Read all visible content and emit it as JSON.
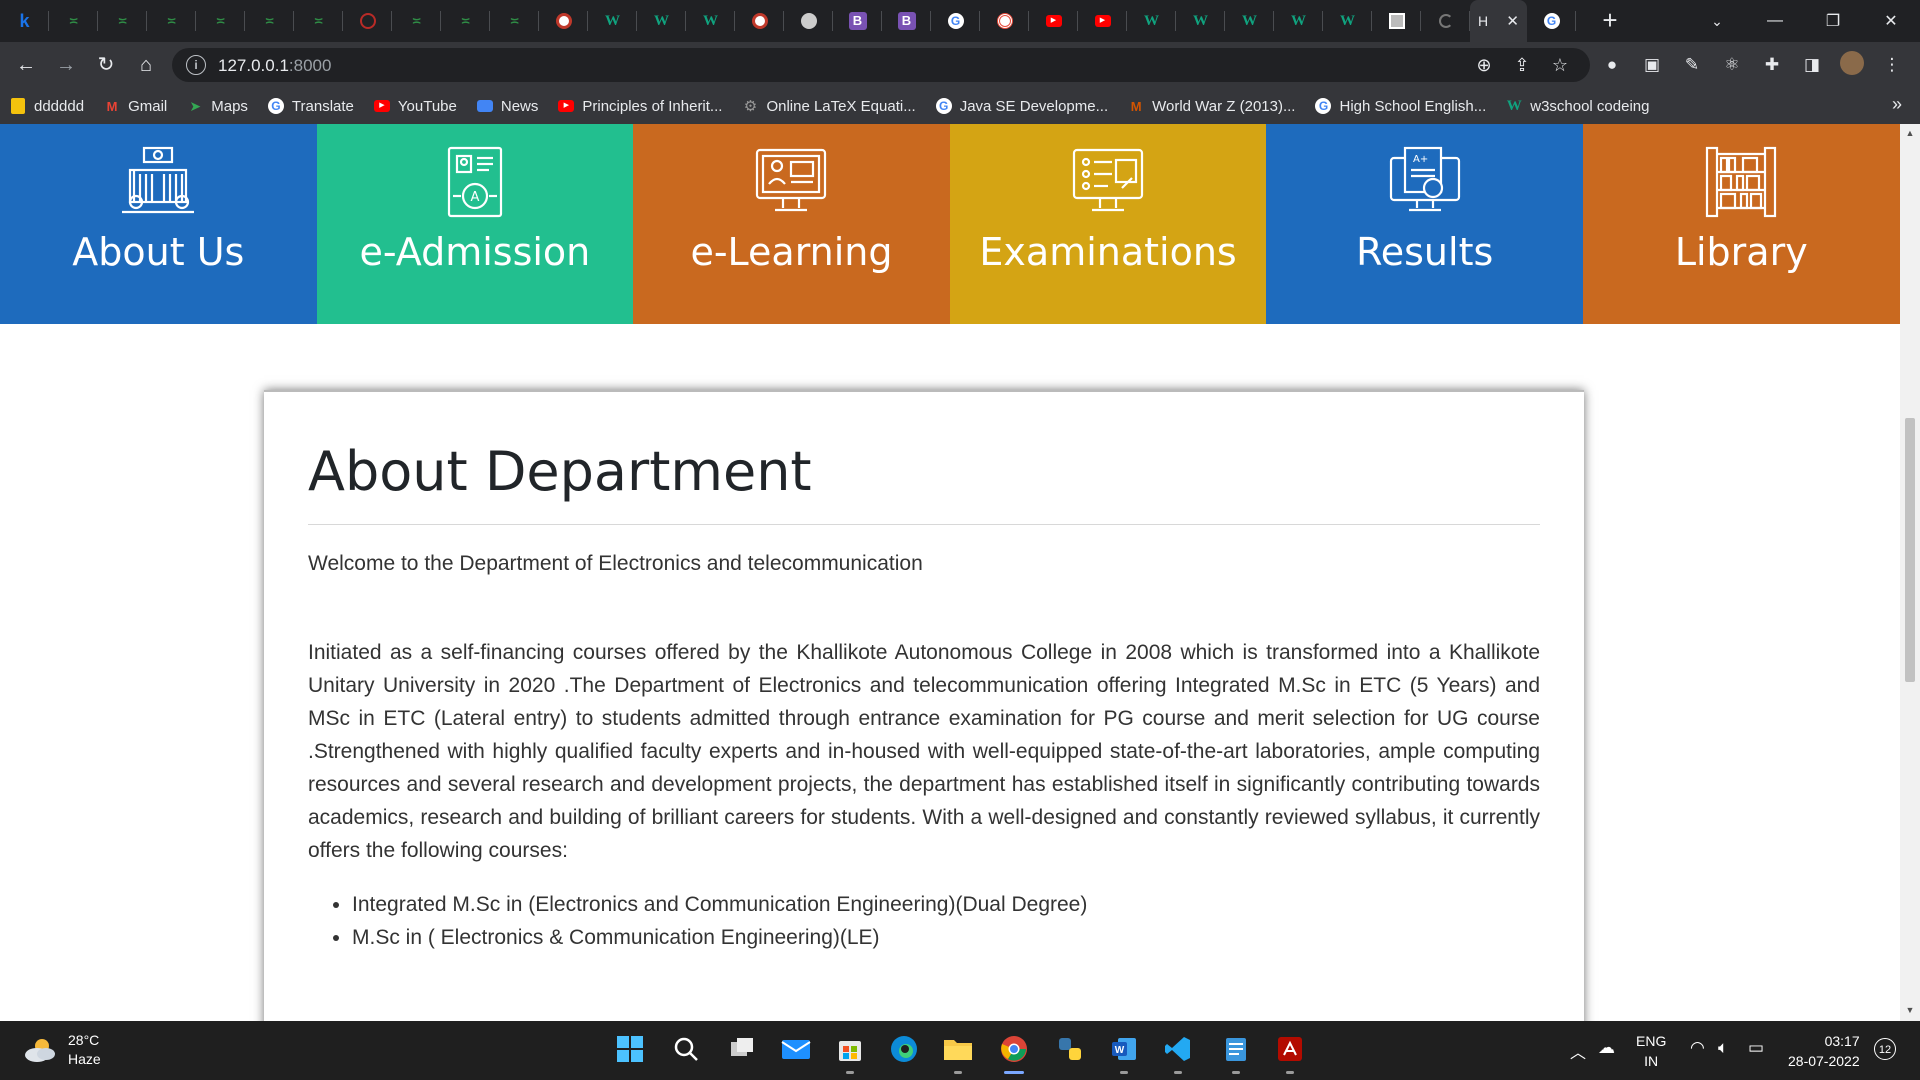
{
  "browser": {
    "tabs": [
      {
        "icon": "k",
        "color": "#1a73e8"
      },
      {
        "icon": "gfg",
        "color": "#2f8d46"
      },
      {
        "icon": "gfg",
        "color": "#2f8d46"
      },
      {
        "icon": "gfg",
        "color": "#2f8d46"
      },
      {
        "icon": "gfg",
        "color": "#2f8d46"
      },
      {
        "icon": "gfg",
        "color": "#2f8d46"
      },
      {
        "icon": "gfg",
        "color": "#2f8d46"
      },
      {
        "icon": "Q",
        "color": "#b92b27"
      },
      {
        "icon": "gfg",
        "color": "#2f8d46"
      },
      {
        "icon": "gfg",
        "color": "#2f8d46"
      },
      {
        "icon": "gfg",
        "color": "#2f8d46"
      },
      {
        "icon": "seal",
        "color": "#c0392b"
      },
      {
        "icon": "W",
        "color": "#10a37f"
      },
      {
        "icon": "W",
        "color": "#10a37f"
      },
      {
        "icon": "W",
        "color": "#10a37f"
      },
      {
        "icon": "seal",
        "color": "#c0392b"
      },
      {
        "icon": "github",
        "color": "#cccccc"
      },
      {
        "icon": "B",
        "color": "#7952b3"
      },
      {
        "icon": "B",
        "color": "#7952b3"
      },
      {
        "icon": "G",
        "color": "#ffffff"
      },
      {
        "icon": "target",
        "color": "#e74c3c"
      },
      {
        "icon": "yt",
        "color": "#ff0000"
      },
      {
        "icon": "yt",
        "color": "#ff0000"
      },
      {
        "icon": "W",
        "color": "#10a37f"
      },
      {
        "icon": "W",
        "color": "#10a37f"
      },
      {
        "icon": "W",
        "color": "#10a37f"
      },
      {
        "icon": "W",
        "color": "#10a37f"
      },
      {
        "icon": "W",
        "color": "#10a37f"
      },
      {
        "icon": "qr",
        "color": "#bbbbbb"
      },
      {
        "icon": "loading",
        "color": "#777777"
      }
    ],
    "active_tab": {
      "title": "H",
      "close": "✕"
    },
    "after_active_tab_icon": "G",
    "new_tab": "+",
    "url": {
      "host": "127.0.0.1",
      "port": ":8000"
    },
    "bookmarks": [
      {
        "label": "dddddd",
        "icon": "folder",
        "color": "#f4c20d"
      },
      {
        "label": "Gmail",
        "icon": "M",
        "color": "#ea4335"
      },
      {
        "label": "Maps",
        "icon": "maps",
        "color": "#34a853"
      },
      {
        "label": "Translate",
        "icon": "G",
        "color": "#4285f4"
      },
      {
        "label": "YouTube",
        "icon": "yt",
        "color": "#ff0000"
      },
      {
        "label": "News",
        "icon": "news",
        "color": "#4285f4"
      },
      {
        "label": "Principles of Inherit...",
        "icon": "yt",
        "color": "#ff0000"
      },
      {
        "label": "Online LaTeX Equati...",
        "icon": "gear",
        "color": "#999999"
      },
      {
        "label": "Java SE Developme...",
        "icon": "G",
        "color": "#f4b400"
      },
      {
        "label": "World War Z (2013)...",
        "icon": "M",
        "color": "#d35400"
      },
      {
        "label": "High School English...",
        "icon": "G",
        "color": "#ffffff"
      },
      {
        "label": "w3school codeing",
        "icon": "W",
        "color": "#10a37f"
      }
    ],
    "bookmarks_more": "»"
  },
  "nav": [
    {
      "label": "About Us",
      "bg": "#1e6bbd",
      "icon": "building-icon"
    },
    {
      "label": "e-Admission",
      "bg": "#22bf8f",
      "icon": "admission-icon"
    },
    {
      "label": "e-Learning",
      "bg": "#c9691f",
      "icon": "elearning-icon"
    },
    {
      "label": "Examinations",
      "bg": "#d4a414",
      "icon": "exam-icon"
    },
    {
      "label": "Results",
      "bg": "#1e6bbd",
      "icon": "results-icon"
    },
    {
      "label": "Library",
      "bg": "#c9691f",
      "icon": "library-icon"
    }
  ],
  "content": {
    "title": "About Department",
    "welcome": "Welcome to the Department of Electronics and telecommunication",
    "paragraph": "Initiated as a self-financing courses offered by the Khallikote Autonomous College in 2008 which is transformed into a Khallikote Unitary University in 2020 .The Department of Electronics and telecommunication offering Integrated M.Sc in ETC (5 Years) and MSc in ETC (Lateral entry) to students admitted through entrance examination for PG course and merit selection for UG course .Strengthened with highly qualified faculty experts and in-housed with well-equipped state-of-the-art laboratories, ample computing resources and several research and development projects, the department has established itself in significantly contributing towards academics, research and building of brilliant careers for students. With a well-designed and constantly reviewed syllabus, it currently offers the following courses:",
    "courses": [
      "Integrated M.Sc in (Electronics and Communication Engineering)(Dual Degree)",
      "M.Sc in ( Electronics & Communication Engineering)(LE)"
    ]
  },
  "taskbar": {
    "weather": {
      "temp": "28°C",
      "condition": "Haze"
    },
    "lang": {
      "line1": "ENG",
      "line2": "IN"
    },
    "time": "03:17",
    "date": "28-07-2022",
    "notifications": "12"
  }
}
